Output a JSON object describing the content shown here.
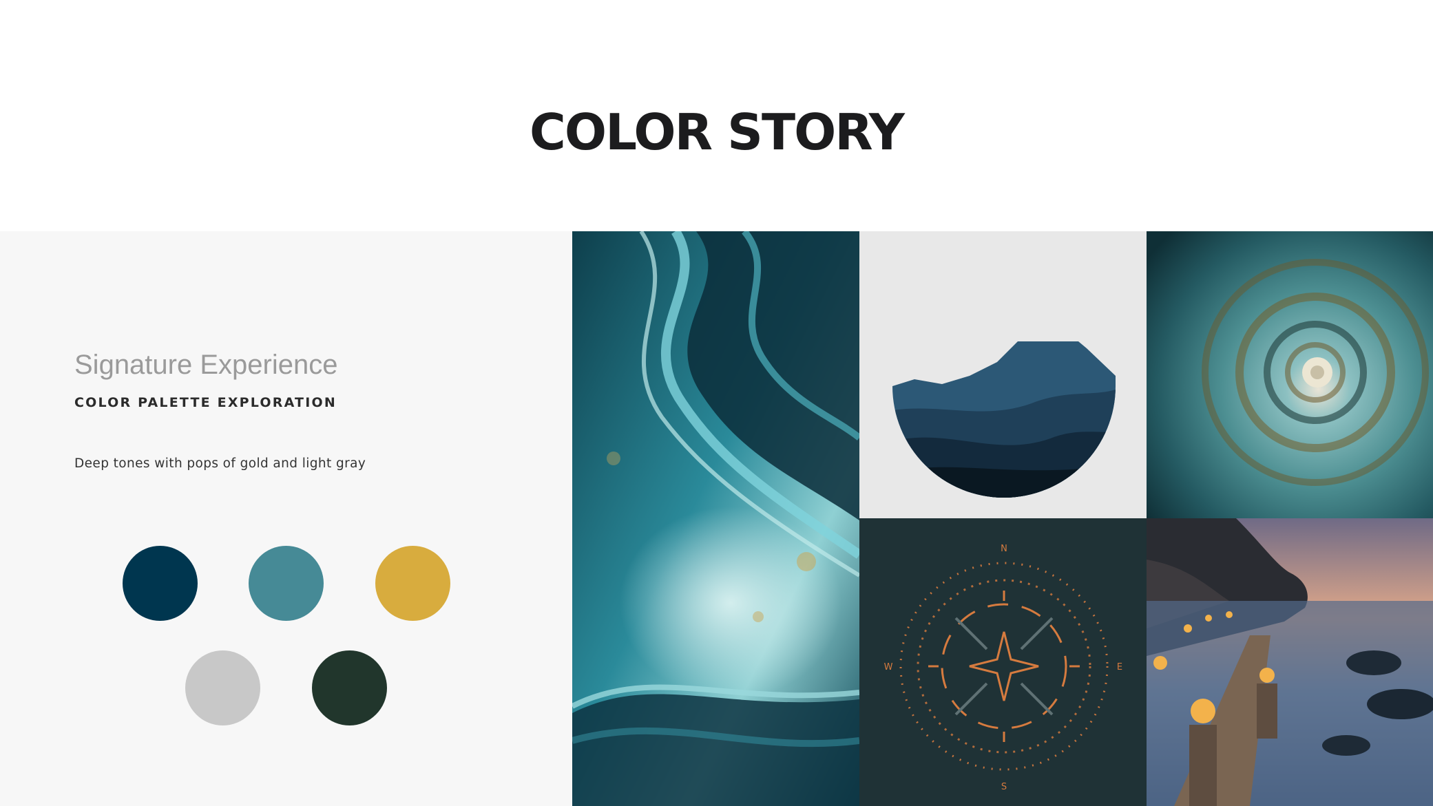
{
  "header": {
    "title": "COLOR STORY"
  },
  "palette_panel": {
    "subtitle": "Signature Experience",
    "kicker": "COLOR PALETTE EXPLORATION",
    "description": "Deep tones with pops of gold and light gray",
    "swatches": [
      {
        "name": "deep-navy",
        "color": "#00364f"
      },
      {
        "name": "teal",
        "color": "#468a96"
      },
      {
        "name": "gold",
        "color": "#d8ac3e"
      },
      {
        "name": "light-gray",
        "color": "#c8c8c8"
      },
      {
        "name": "forest-green",
        "color": "#21362c"
      }
    ]
  },
  "moodboard": {
    "images": [
      {
        "name": "teal-marble-texture-image"
      },
      {
        "name": "mountain-moon-logo-image"
      },
      {
        "name": "spiral-shell-image"
      },
      {
        "name": "compass-emblem-image"
      },
      {
        "name": "lantern-pier-sunset-image"
      }
    ],
    "compass_letter_n": "N",
    "compass_letter_s": "S",
    "compass_letter_w": "W",
    "compass_letter_e": "E"
  }
}
